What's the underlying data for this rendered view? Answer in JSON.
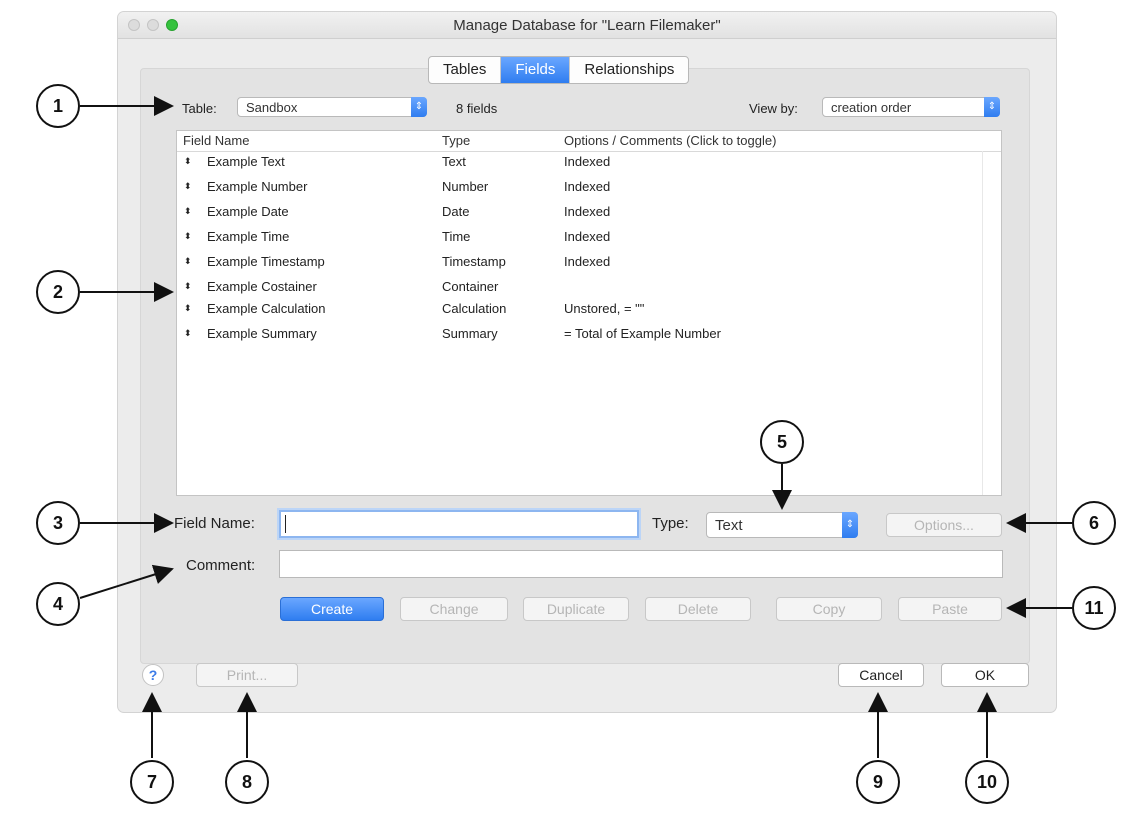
{
  "window": {
    "title": "Manage Database for \"Learn Filemaker\""
  },
  "tabs": [
    "Tables",
    "Fields",
    "Relationships"
  ],
  "active_tab": "Fields",
  "table_selector": {
    "label": "Table:",
    "value": "Sandbox",
    "count": "8 fields"
  },
  "view_by": {
    "label": "View by:",
    "value": "creation order"
  },
  "field_list": {
    "columns": [
      "Field Name",
      "Type",
      "Options / Comments   (Click to toggle)"
    ],
    "rows": [
      {
        "name": "Example Text",
        "type": "Text",
        "options": "Indexed"
      },
      {
        "name": "Example Number",
        "type": "Number",
        "options": "Indexed"
      },
      {
        "name": "Example Date",
        "type": "Date",
        "options": "Indexed"
      },
      {
        "name": "Example Time",
        "type": "Time",
        "options": "Indexed"
      },
      {
        "name": "Example Timestamp",
        "type": "Timestamp",
        "options": "Indexed"
      },
      {
        "name": "Example Costainer",
        "type": "Container",
        "options": ""
      },
      {
        "name": "Example Calculation",
        "type": "Calculation",
        "options": "Unstored, = \"\""
      },
      {
        "name": "Example Summary",
        "type": "Summary",
        "options": "= Total of Example Number"
      }
    ]
  },
  "form": {
    "field_name_label": "Field Name:",
    "field_name_value": "",
    "type_label": "Type:",
    "type_value": "Text",
    "options_button": "Options...",
    "comment_label": "Comment:",
    "comment_value": ""
  },
  "actions": {
    "create": "Create",
    "change": "Change",
    "duplicate": "Duplicate",
    "delete": "Delete",
    "copy": "Copy",
    "paste": "Paste"
  },
  "footer": {
    "help": "?",
    "print": "Print...",
    "cancel": "Cancel",
    "ok": "OK"
  },
  "callouts": [
    "1",
    "2",
    "3",
    "4",
    "5",
    "6",
    "7",
    "8",
    "9",
    "10",
    "11"
  ],
  "colors": {
    "accent": "#2f7df0",
    "window_bg": "#ececec",
    "zoom_light": "#35c23e"
  }
}
